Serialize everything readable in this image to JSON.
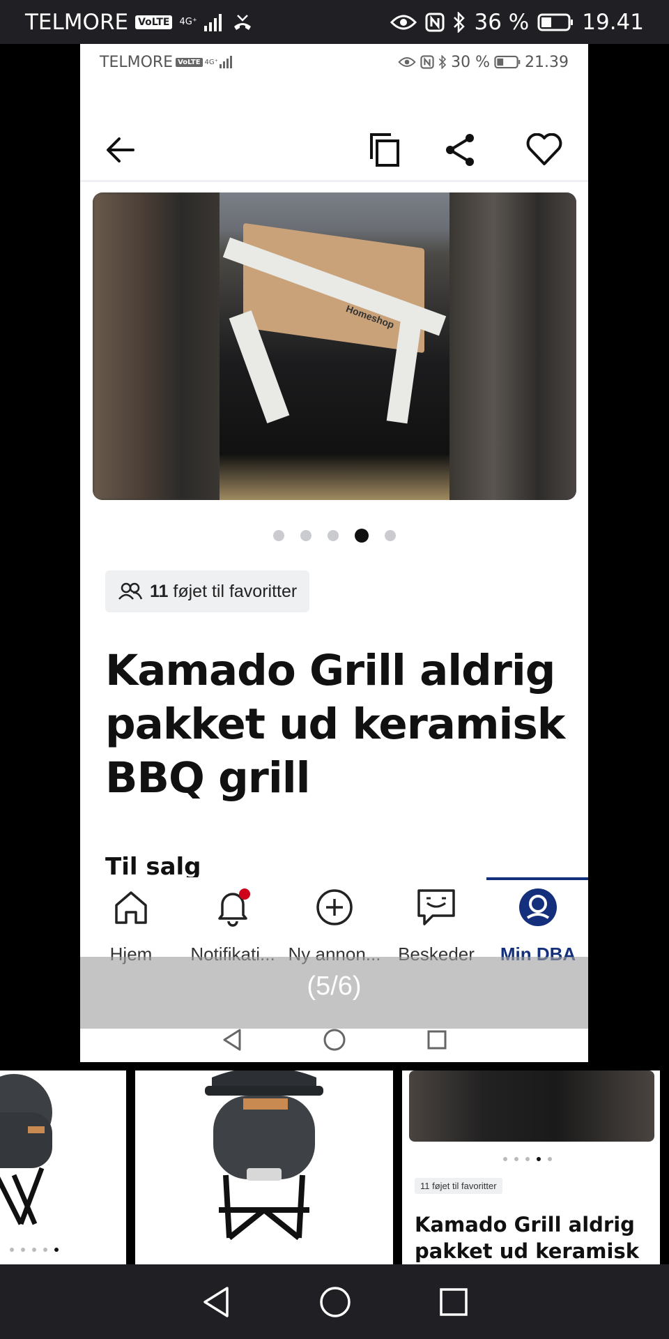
{
  "outer_status": {
    "carrier": "TELMORE",
    "volte": "VoLTE",
    "network": "4G⁺",
    "battery": "36 %",
    "time": "19.41"
  },
  "inner_status": {
    "carrier": "TELMORE",
    "volte": "VoLTE",
    "network": "4G⁺",
    "battery": "30 %",
    "time": "21.39"
  },
  "toolbar": {
    "back_icon": "arrow-left-icon",
    "copy_icon": "copy-icon",
    "share_icon": "share-icon",
    "favorite_icon": "heart-icon"
  },
  "gallery": {
    "tape_text": "Homeshop",
    "dots_count": 5,
    "active_dot": 4
  },
  "listing": {
    "favorites_count": "11",
    "favorites_label": "føjet til favoritter",
    "title": "Kamado Grill aldrig pakket ud keramisk BBQ grill",
    "subtitle": "Til salg"
  },
  "bottom_nav": {
    "items": [
      {
        "label": "Hjem",
        "icon": "home-icon",
        "active": false
      },
      {
        "label": "Notifikati...",
        "icon": "bell-icon",
        "active": false
      },
      {
        "label": "Ny annon...",
        "icon": "plus-circle-icon",
        "active": false
      },
      {
        "label": "Beskeder",
        "icon": "chat-icon",
        "active": false
      },
      {
        "label": "Min DBA",
        "icon": "profile-icon",
        "active": true
      }
    ]
  },
  "overlay": {
    "counter": "(5/6)"
  },
  "thumbnail_3": {
    "badge": "11 føjet til favoritter",
    "title": "Kamado Grill aldrig pakket ud keramisk"
  },
  "colors": {
    "accent": "#14307c",
    "notification_dot": "#d0021b",
    "chip_bg": "#eff0f2"
  }
}
